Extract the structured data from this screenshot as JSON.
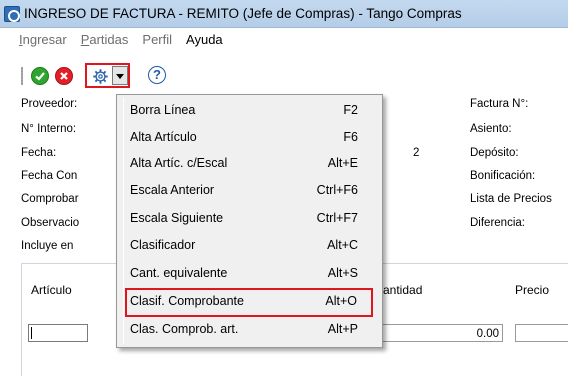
{
  "window": {
    "title": "INGRESO DE FACTURA - REMITO (Jefe de Compras) - Tango Compras"
  },
  "menu": [
    {
      "label": "Ingresar",
      "mnemonic": "I",
      "rest": "ngresar"
    },
    {
      "label": "Partidas",
      "mnemonic": "P",
      "rest": "artidas"
    },
    {
      "label": "Perfil",
      "mnemonic": "",
      "rest": "Perfil"
    },
    {
      "label": "Ayuda",
      "mnemonic": "",
      "rest": "Ayuda"
    }
  ],
  "toolbar": {
    "help_label": "?"
  },
  "form": {
    "left_labels": [
      "Proveedor:",
      "N° Interno:",
      "Fecha:",
      "Fecha Con",
      "Comprobar",
      "Observacio",
      "Incluye en"
    ],
    "right_labels": [
      "Factura N°:",
      "Asiento:",
      "Depósito:",
      "Bonificación:",
      "Lista de Precios",
      "Diferencia:"
    ],
    "mid_value": "2"
  },
  "grid": {
    "headers": [
      "Artículo",
      "antidad",
      "Precio"
    ],
    "row": {
      "quantity": "0.00"
    }
  },
  "popup_menu": [
    {
      "label": "Borra Línea",
      "shortcut": "F2"
    },
    {
      "label": "Alta Artículo",
      "shortcut": "F6"
    },
    {
      "label": "Alta Artíc. c/Escal",
      "shortcut": "Alt+E"
    },
    {
      "label": "Escala Anterior",
      "shortcut": "Ctrl+F6"
    },
    {
      "label": "Escala Siguiente",
      "shortcut": "Ctrl+F7"
    },
    {
      "label": "Clasificador",
      "shortcut": "Alt+C"
    },
    {
      "label": "Cant. equivalente",
      "shortcut": "Alt+S"
    },
    {
      "label": "Clasif. Comprobante",
      "shortcut": "Alt+O"
    },
    {
      "label": "Clas. Comprob. art.",
      "shortcut": "Alt+P"
    }
  ],
  "colors": {
    "highlight_border": "#e0161f",
    "title_bar": "#c3d9ee",
    "ok": "#2ea52e",
    "cancel": "#e21f26"
  }
}
